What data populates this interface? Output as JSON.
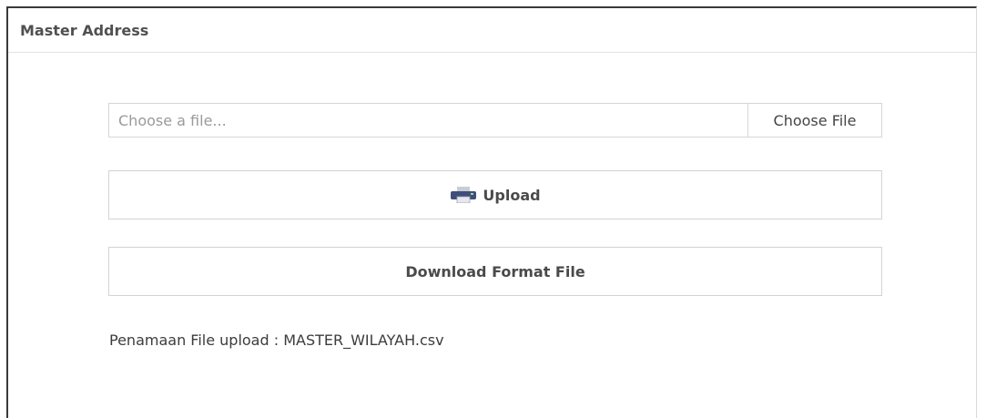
{
  "panel": {
    "title": "Master Address"
  },
  "file_input": {
    "placeholder": "Choose a file...",
    "choose_button_label": "Choose File"
  },
  "buttons": {
    "upload_label": "Upload",
    "upload_icon": "printer-icon",
    "download_label": "Download Format File"
  },
  "note": {
    "text": "Penamaan File upload : MASTER_WILAYAH.csv"
  },
  "colors": {
    "title_text": "#505050",
    "button_text": "#4a4a4a",
    "border": "#d3d3d3",
    "icon_blue": "#3e4f7a"
  }
}
